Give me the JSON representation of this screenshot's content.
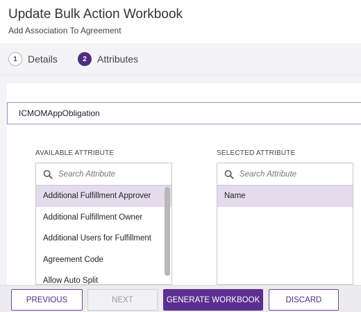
{
  "header": {
    "title": "Update Bulk Action Workbook",
    "subtitle": "Add Association To Agreement"
  },
  "steps": [
    {
      "number": "1",
      "label": "Details",
      "active": false
    },
    {
      "number": "2",
      "label": "Attributes",
      "active": true
    }
  ],
  "obligation": "ICMOMAppObligation",
  "available": {
    "heading": "AVAILABLE ATTRIBUTE",
    "search_placeholder": "Search Attribute",
    "items": [
      "Additional Fulfillment Approver",
      "Additional Fulfillment Owner",
      "Additional Users for Fulfillment",
      "Agreement Code",
      "Allow Auto Split"
    ]
  },
  "selected": {
    "heading": "SELECTED ATTRIBUTE",
    "search_placeholder": "Search Attribute",
    "items": [
      "Name"
    ]
  },
  "footer": {
    "previous": "PREVIOUS",
    "next": "NEXT",
    "generate": "GENERATE WORKBOOK",
    "discard": "DISCARD"
  },
  "colors": {
    "accent": "#5b2e91",
    "selected_row": "#e4dced"
  }
}
